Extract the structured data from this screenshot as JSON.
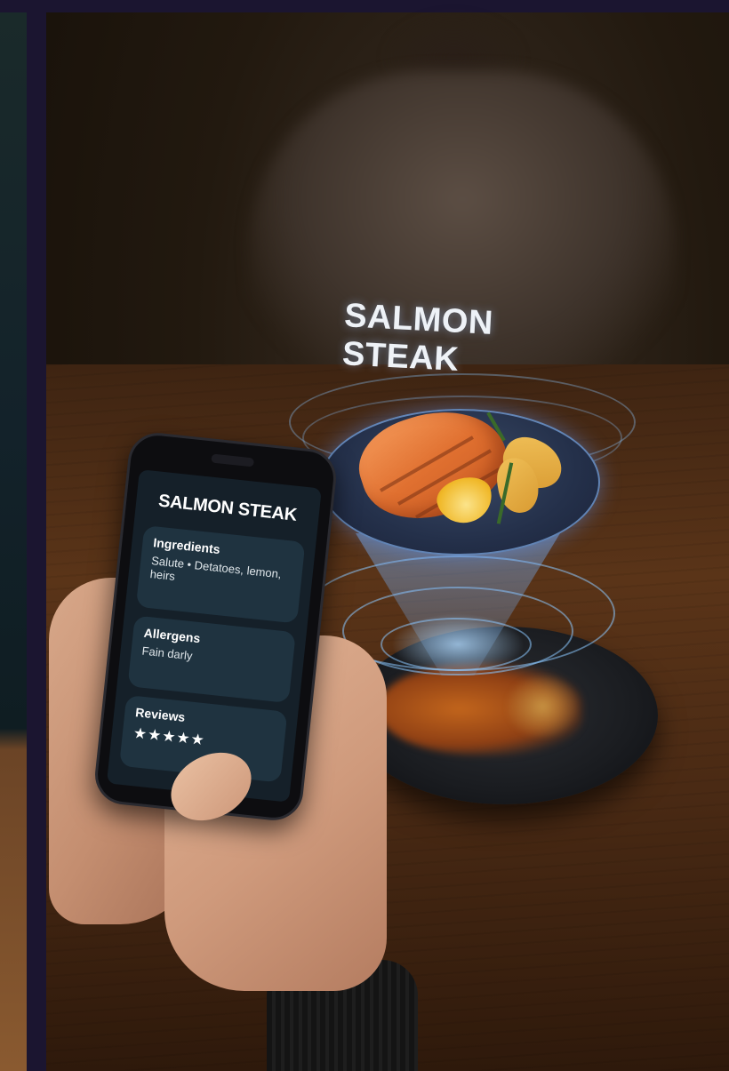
{
  "hologram": {
    "title": "SALMON STEAK"
  },
  "phone_app": {
    "title": "SALMON STEAK",
    "ingredients": {
      "heading": "Ingredients",
      "text": "Salute • Detatoes, lemon, heirs"
    },
    "allergens": {
      "heading": "Allergens",
      "text": "Fain darly"
    },
    "reviews": {
      "heading": "Reviews",
      "stars": "★★★★★",
      "rating": 5,
      "max_rating": 5
    }
  },
  "colors": {
    "hologram_blue": "#8cc8ff",
    "phone_screen": "#152029",
    "card_bg": "#1f3340",
    "table_wood": "#5a3418"
  }
}
